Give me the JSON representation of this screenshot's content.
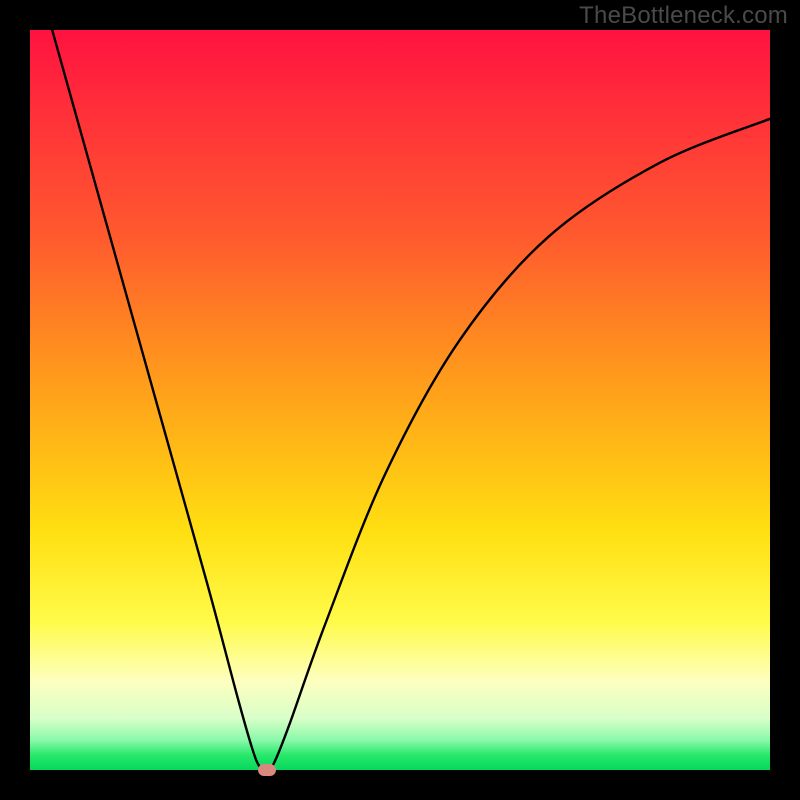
{
  "watermark": "TheBottleneck.com",
  "chart_data": {
    "type": "line",
    "title": "",
    "xlabel": "",
    "ylabel": "",
    "xlim": [
      0,
      100
    ],
    "ylim": [
      0,
      100
    ],
    "grid": false,
    "series": [
      {
        "name": "bottleneck-curve",
        "x": [
          3,
          10,
          17,
          24,
          28,
          30,
          31,
          32,
          33,
          35,
          40,
          48,
          58,
          70,
          85,
          100
        ],
        "values": [
          100,
          75,
          50,
          25,
          10,
          3,
          0.5,
          0,
          1,
          6,
          20,
          40,
          58,
          72,
          82,
          88
        ]
      }
    ],
    "annotations": [
      {
        "name": "marker-dot",
        "x": 32,
        "y": 0,
        "shape": "pill",
        "color": "#d98880"
      }
    ],
    "background": "red-to-green-vertical-gradient"
  }
}
